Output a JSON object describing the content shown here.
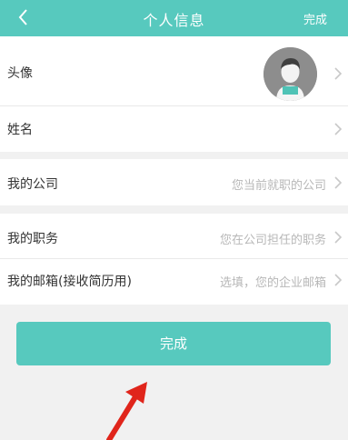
{
  "header": {
    "title": "个人信息",
    "done_label": "完成"
  },
  "rows": {
    "avatar": {
      "label": "头像"
    },
    "name": {
      "label": "姓名"
    },
    "company": {
      "label": "我的公司",
      "placeholder": "您当前就职的公司"
    },
    "position": {
      "label": "我的职务",
      "placeholder": "您在公司担任的职务"
    },
    "email": {
      "label": "我的邮箱(接收简历用)",
      "placeholder": "选填，您的企业邮箱"
    }
  },
  "submit": {
    "label": "完成"
  },
  "colors": {
    "accent": "#57c9be",
    "annotation_arrow": "#e0251b"
  },
  "icons": {
    "back": "chevron-left-icon",
    "row_arrow": "chevron-right-icon",
    "avatar": "default-avatar-icon"
  }
}
